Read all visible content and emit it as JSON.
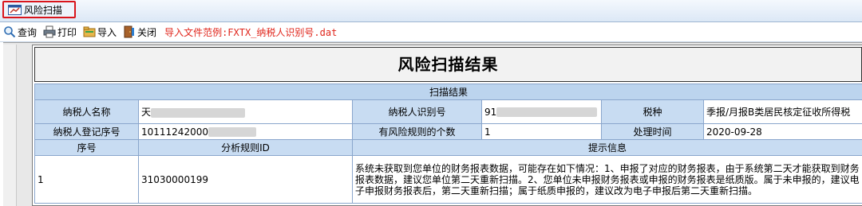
{
  "tab": {
    "label": "风险扫描"
  },
  "toolbar": {
    "query": "查询",
    "print": "打印",
    "import": "导入",
    "close": "关闭",
    "hint": "导入文件范例:FXTX_纳税人识别号.dat"
  },
  "report": {
    "title": "风险扫描结果",
    "section": "扫描结果",
    "taxpayer_name_label": "纳税人名称",
    "taxpayer_name_value": "天",
    "taxpayer_id_label": "纳税人识别号",
    "taxpayer_id_value": "91",
    "tax_type_label": "税种",
    "tax_type_value": "季报/月报B类居民核定征收所得税",
    "reg_no_label": "纳税人登记序号",
    "reg_no_value": "10111242000",
    "risk_count_label": "有风险规则的个数",
    "risk_count_value": "1",
    "process_time_label": "处理时间",
    "process_time_value": "2020-09-28",
    "col_seq": "序号",
    "col_rule_id": "分析规则ID",
    "col_tip": "提示信息",
    "rows": [
      {
        "seq": "1",
        "rule_id": "31030000199",
        "tip": "系统未获取到您单位的财务报表数据，可能存在如下情况：1、申报了对应的财务报表，由于系统第二天才能获取到财务报表数据，建议您单位第二天重新扫描。2、您单位未申报财务报表或申报的财务报表是纸质版。属于未申报的，建议电子申报财务报表后，第二天重新扫描；属于纸质申报的，建议改为电子申报后第二天重新扫描。"
      }
    ]
  }
}
